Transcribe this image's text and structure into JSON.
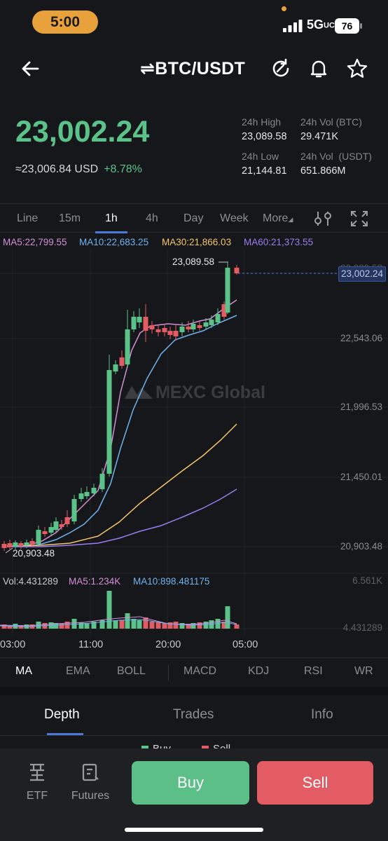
{
  "status_bar": {
    "time": "5:00",
    "network": "5G",
    "battery": "76"
  },
  "header": {
    "pair": "⇌BTC/USDT"
  },
  "price": {
    "last": "23,002.24",
    "usd_equiv": "≈23,006.84 USD",
    "change": "+8.78%",
    "stats": {
      "high_label": "24h High",
      "high_value": "23,089.58",
      "vol_btc_label": "24h Vol (BTC)",
      "vol_btc_value": "29.471K",
      "low_label": "24h Low",
      "low_value": "21,144.81",
      "vol_usdt_label": "24h Vol  (USDT)",
      "vol_usdt_value": "651.866M"
    }
  },
  "timeframes": [
    "Line",
    "15m",
    "1h",
    "4h",
    "Day",
    "Week",
    "More"
  ],
  "active_timeframe": "1h",
  "ma_legend": {
    "ma5": "MA5:22,799.55",
    "ma10": "MA10:22,683.25",
    "ma30": "MA30:21,866.03",
    "ma60": "MA60:21,373.55"
  },
  "chart": {
    "watermark": "MEXC Global",
    "current_price_tag": "23,002.24",
    "high_marker": "23,089.58",
    "low_marker": "20,903.48",
    "axis_labels": [
      "23,089.58",
      "22,543.06",
      "21,996.53",
      "21,450.01",
      "20,903.48"
    ],
    "volume_axis": [
      "6.561K",
      "4.431289"
    ],
    "time_labels": [
      "03:00",
      "11:00",
      "20:00",
      "05:00"
    ]
  },
  "volume_legend": {
    "vol": "Vol:4.431289",
    "ma5": "MA5:1.234K",
    "ma10": "MA10:898.481175"
  },
  "indicators": [
    "MA",
    "EMA",
    "BOLL",
    "MACD",
    "KDJ",
    "RSI",
    "WR"
  ],
  "active_indicator": "MA",
  "bottom_tabs": [
    "Depth",
    "Trades",
    "Info"
  ],
  "active_bottom_tab": "Depth",
  "depth_legend": {
    "buy": "Buy",
    "sell": "Sell"
  },
  "bottom_bar": {
    "etf": "ETF",
    "futures": "Futures",
    "buy": "Buy",
    "sell": "Sell"
  },
  "colors": {
    "up": "#5bc389",
    "down": "#e45c63",
    "accent": "#4b79d9",
    "ma5": "#d38fd8",
    "ma10": "#6fb3ef",
    "ma30": "#f3c46b",
    "ma60": "#9a7df0"
  }
}
